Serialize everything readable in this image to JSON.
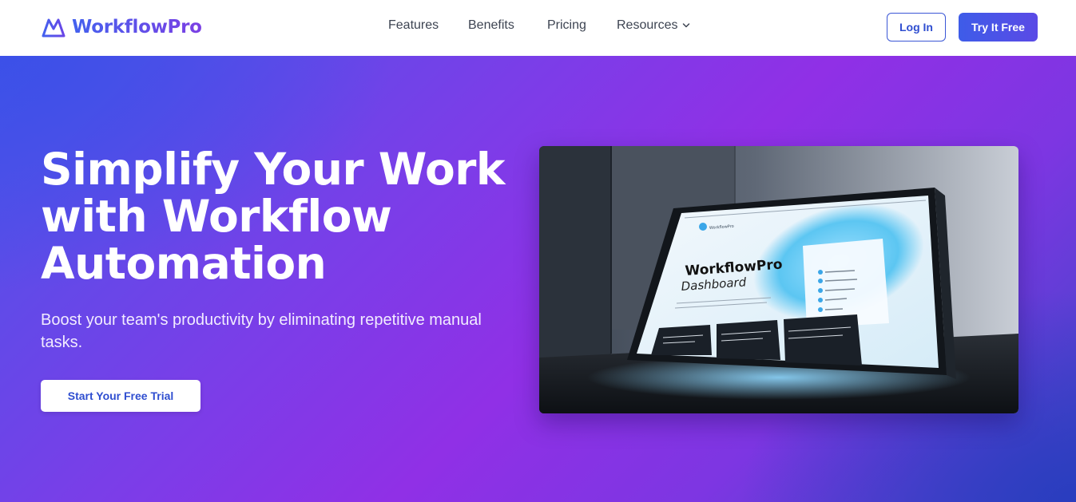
{
  "brand": {
    "name": "WorkflowPro",
    "logo_icon": "mountain-logo-icon"
  },
  "nav": {
    "features": "Features",
    "benefits": "Benefits",
    "pricing": "Pricing",
    "resources": "Resources"
  },
  "header_actions": {
    "login": "Log In",
    "try_free": "Try It Free"
  },
  "hero": {
    "headline": "Simplify Your Work with Workflow Automation",
    "subheadline": "Boost your team's productivity by eliminating repetitive manual tasks.",
    "cta": "Start Your Free Trial",
    "image": {
      "screen_title": "WorkflowPro",
      "screen_subtitle": "Dashboard",
      "screen_brand": "WorkflowPro"
    }
  },
  "colors": {
    "brand_blue": "#3e5ce8",
    "brand_purple": "#7b3fe4",
    "hero_gradient_mid": "#9030e6",
    "text_white": "#ffffff"
  }
}
